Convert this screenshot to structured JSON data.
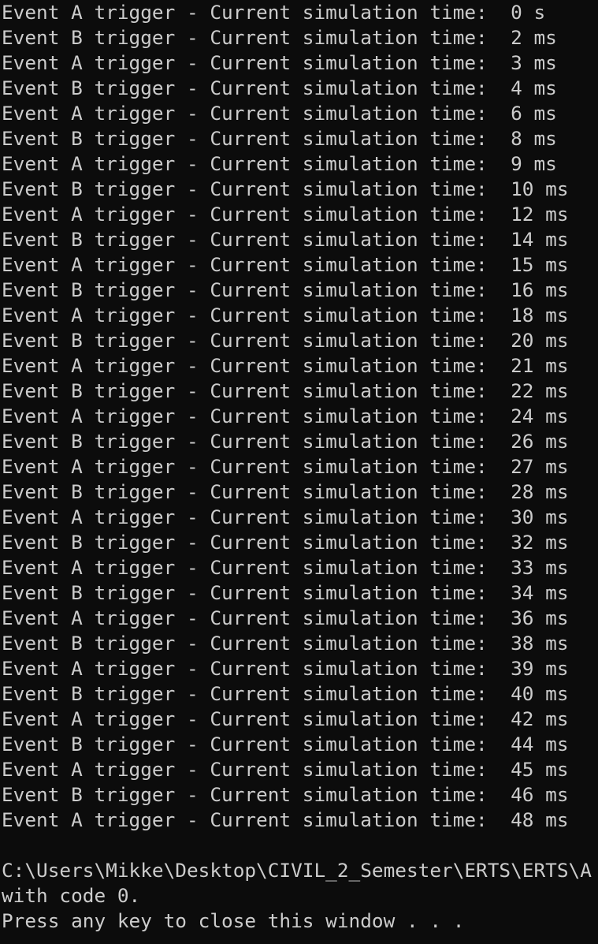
{
  "console": {
    "lines": [
      "Event A trigger - Current simulation time:  0 s",
      "Event B trigger - Current simulation time:  2 ms",
      "Event A trigger - Current simulation time:  3 ms",
      "Event B trigger - Current simulation time:  4 ms",
      "Event A trigger - Current simulation time:  6 ms",
      "Event B trigger - Current simulation time:  8 ms",
      "Event A trigger - Current simulation time:  9 ms",
      "Event B trigger - Current simulation time:  10 ms",
      "Event A trigger - Current simulation time:  12 ms",
      "Event B trigger - Current simulation time:  14 ms",
      "Event A trigger - Current simulation time:  15 ms",
      "Event B trigger - Current simulation time:  16 ms",
      "Event A trigger - Current simulation time:  18 ms",
      "Event B trigger - Current simulation time:  20 ms",
      "Event A trigger - Current simulation time:  21 ms",
      "Event B trigger - Current simulation time:  22 ms",
      "Event A trigger - Current simulation time:  24 ms",
      "Event B trigger - Current simulation time:  26 ms",
      "Event A trigger - Current simulation time:  27 ms",
      "Event B trigger - Current simulation time:  28 ms",
      "Event A trigger - Current simulation time:  30 ms",
      "Event B trigger - Current simulation time:  32 ms",
      "Event A trigger - Current simulation time:  33 ms",
      "Event B trigger - Current simulation time:  34 ms",
      "Event A trigger - Current simulation time:  36 ms",
      "Event B trigger - Current simulation time:  38 ms",
      "Event A trigger - Current simulation time:  39 ms",
      "Event B trigger - Current simulation time:  40 ms",
      "Event A trigger - Current simulation time:  42 ms",
      "Event B trigger - Current simulation time:  44 ms",
      "Event A trigger - Current simulation time:  45 ms",
      "Event B trigger - Current simulation time:  46 ms",
      "Event A trigger - Current simulation time:  48 ms"
    ],
    "exit_path_line": "C:\\Users\\Mikke\\Desktop\\CIVIL_2_Semester\\ERTS\\ERTS\\A",
    "exit_code_line": "with code 0.",
    "close_prompt_line": "Press any key to close this window . . ."
  },
  "colors": {
    "background": "#0c0c0c",
    "text": "#cccccc"
  }
}
